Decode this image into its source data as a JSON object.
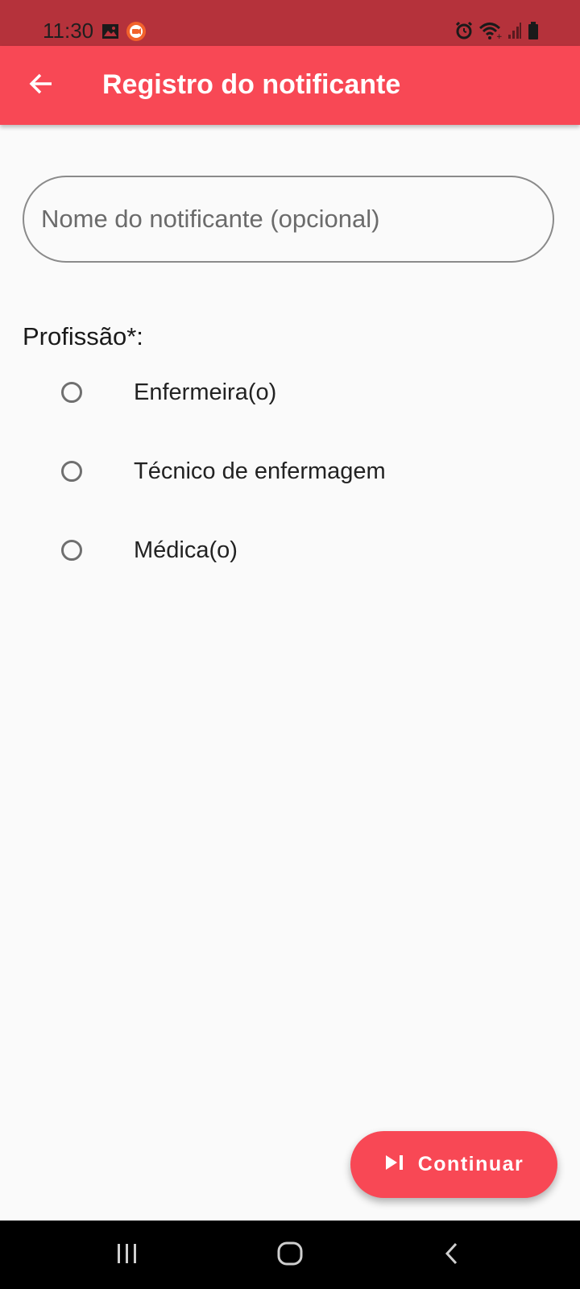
{
  "status_bar": {
    "time": "11:30",
    "left_icons": [
      "image-icon",
      "recorder-icon"
    ],
    "right_icons": [
      "alarm-icon",
      "wifi-icon",
      "signal-icon",
      "battery-icon"
    ]
  },
  "app_bar": {
    "back_icon": "arrow-back-icon",
    "title": "Registro do notificante",
    "background_color": "#f84855"
  },
  "form": {
    "name_field": {
      "placeholder": "Nome do notificante (opcional)",
      "value": ""
    },
    "profession_label": "Profissão*:",
    "profession_options": [
      {
        "label": "Enfermeira(o)",
        "selected": false
      },
      {
        "label": "Técnico de enfermagem",
        "selected": false
      },
      {
        "label": "Médica(o)",
        "selected": false
      }
    ]
  },
  "continue_button": {
    "icon": "skip-next-icon",
    "label": "Continuar"
  },
  "nav_bar": {
    "icons": [
      "recent-apps-icon",
      "home-icon",
      "back-nav-icon"
    ]
  },
  "colors": {
    "status_bar": "#b5323b",
    "accent": "#f84855",
    "background": "#fafafa"
  }
}
